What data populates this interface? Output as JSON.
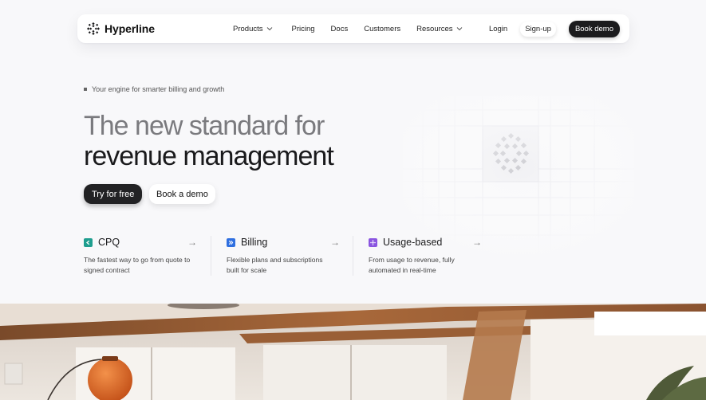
{
  "nav": {
    "brand": "Hyperline",
    "links": [
      {
        "label": "Products",
        "has_dropdown": true
      },
      {
        "label": "Pricing",
        "has_dropdown": false
      },
      {
        "label": "Docs",
        "has_dropdown": false
      },
      {
        "label": "Customers",
        "has_dropdown": false
      },
      {
        "label": "Resources",
        "has_dropdown": true
      }
    ],
    "login": "Login",
    "signup": "Sign-up",
    "book_demo": "Book demo"
  },
  "hero": {
    "eyebrow": "Your engine for smarter billing and growth",
    "headline_line1": "The new standard for",
    "headline_line2": "revenue management",
    "cta_primary": "Try for free",
    "cta_secondary": "Book a demo"
  },
  "features": [
    {
      "title": "CPQ",
      "desc_line1": "The fastest way to go from quote to",
      "desc_line2": "signed contract",
      "icon": "cpq-icon",
      "color": "#1f9e8f"
    },
    {
      "title": "Billing",
      "desc_line1": "Flexible plans and subscriptions",
      "desc_line2": "built for scale",
      "icon": "billing-icon",
      "color": "#2f6fe0"
    },
    {
      "title": "Usage-based",
      "desc_line1": "From usage to revenue, fully",
      "desc_line2": "automated in real-time",
      "icon": "usage-icon",
      "color": "#8a55e0"
    }
  ],
  "colors": {
    "background": "#f8f8fa",
    "primary_button": "#222224",
    "headline_muted": "#7a7a7e",
    "headline_dark": "#1a1a1c"
  }
}
